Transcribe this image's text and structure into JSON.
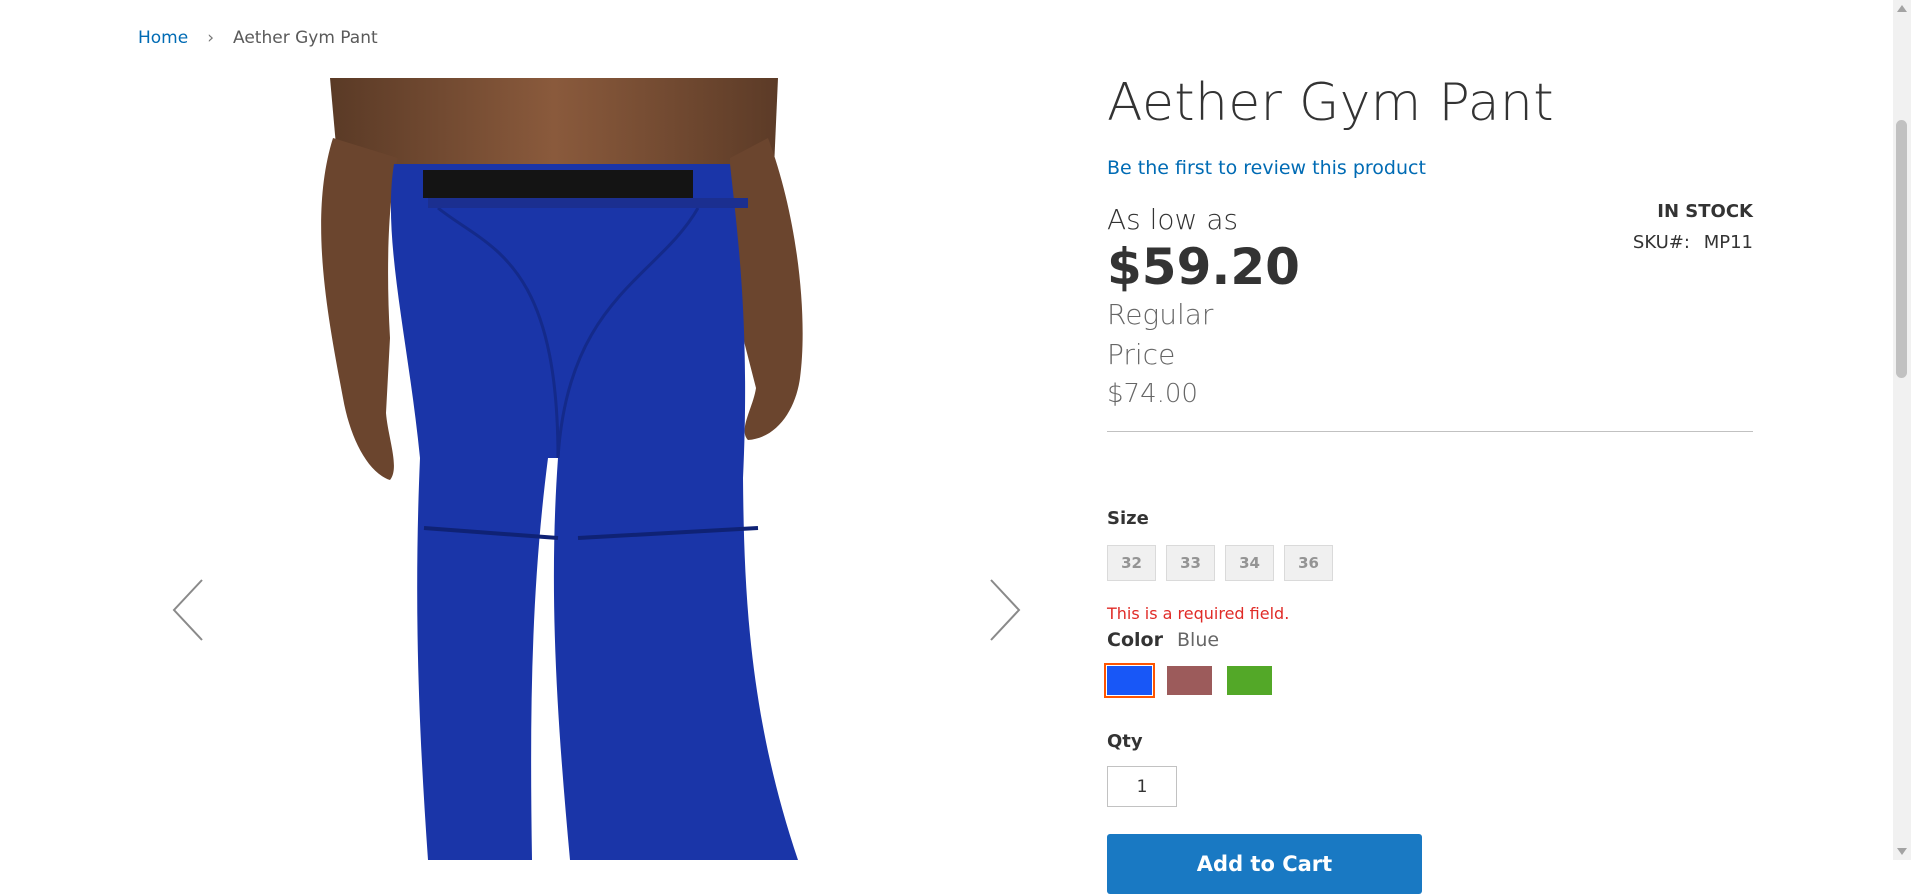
{
  "breadcrumb": {
    "home": "Home",
    "separator": "›",
    "current": "Aether Gym Pant"
  },
  "product": {
    "title": "Aether Gym Pant",
    "review_link": "Be the first to review this product",
    "stock": "IN STOCK",
    "sku_label": "SKU#:",
    "sku_value": "MP11",
    "as_low_as": "As low as",
    "price": "$59.20",
    "regular_price_label": "Regular Price",
    "regular_price": "$74.00"
  },
  "options": {
    "size_label": "Size",
    "sizes": [
      "32",
      "33",
      "34",
      "36"
    ],
    "error": "This is a required field.",
    "color_label": "Color",
    "color_value": "Blue",
    "colors": [
      {
        "name": "blue",
        "hex": "#1857f7",
        "selected": true
      },
      {
        "name": "brown",
        "hex": "#9c5b5b",
        "selected": false
      },
      {
        "name": "green",
        "hex": "#53a828",
        "selected": false
      }
    ],
    "qty_label": "Qty",
    "qty_value": "1",
    "add_to_cart": "Add to Cart"
  },
  "colors": {
    "link": "#006bb4",
    "error": "#e02b27",
    "primary_button": "#1979c3",
    "swatch_selected_outline": "#ff5501",
    "product_pant": "#1a35a8"
  },
  "icons": {
    "prev": "chevron-left-icon",
    "next": "chevron-right-icon"
  }
}
